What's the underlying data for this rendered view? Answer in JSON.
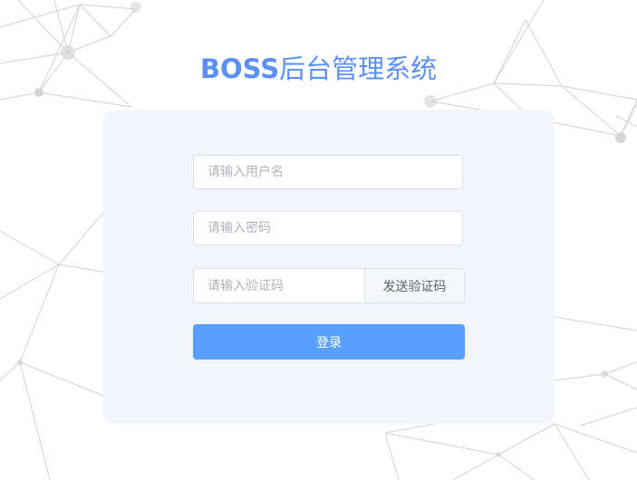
{
  "header": {
    "brand": "BOSS",
    "title": "后台管理系统"
  },
  "login_form": {
    "username_placeholder": "请输入用户名",
    "password_placeholder": "请输入密码",
    "code_placeholder": "请输入验证码",
    "send_code_label": "发送验证码",
    "submit_label": "登录"
  },
  "colors": {
    "title": "#5b8ff9",
    "card_background": "#f2f5fc",
    "primary_button": "#58a0ff",
    "background_lines": "#c8c8c8"
  }
}
